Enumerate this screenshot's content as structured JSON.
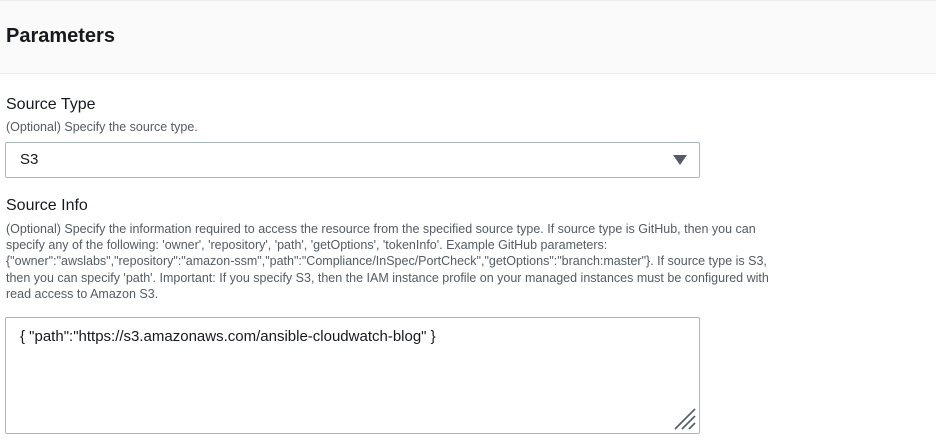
{
  "panel": {
    "title": "Parameters"
  },
  "source_type": {
    "label": "Source Type",
    "description": "(Optional) Specify the source type.",
    "selected": "S3",
    "caret_icon": "caret-down-icon"
  },
  "source_info": {
    "label": "Source Info",
    "description_lines": [
      "(Optional) Specify the information required to access the resource from the specified source type. If source type is GitHub, then you can",
      "specify any of the following: 'owner', 'repository', 'path', 'getOptions', 'tokenInfo'. Example GitHub parameters:",
      "{\"owner\":\"awslabs\",\"repository\":\"amazon-ssm\",\"path\":\"Compliance/InSpec/PortCheck\",\"getOptions\":\"branch:master\"}. If source type is S3,",
      "then you can specify 'path'. Important: If you specify S3, then the IAM instance profile on your managed instances must be configured with",
      "read access to Amazon S3."
    ],
    "value": "{ \"path\":\"https://s3.amazonaws.com/ansible-cloudwatch-blog\" }",
    "resize_icon": "resize-handle-icon"
  },
  "colors": {
    "text": "#16191f",
    "description": "#545b64",
    "border": "#aab7b8",
    "header_bg": "#fafafa"
  }
}
